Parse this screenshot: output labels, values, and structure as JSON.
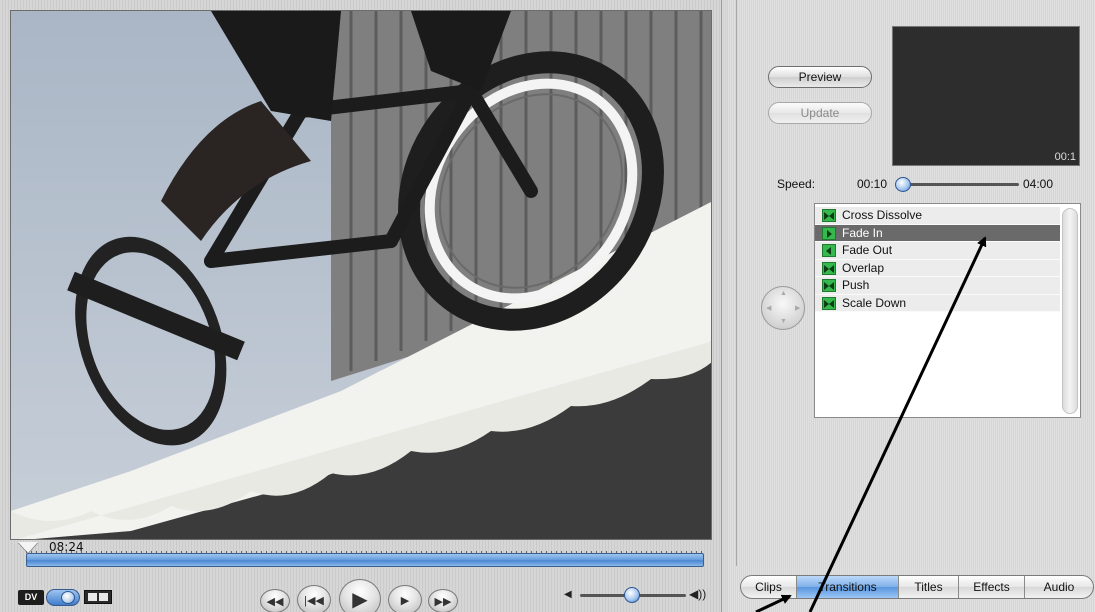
{
  "monitor": {
    "timecode": "08:24",
    "dv_label": "DV",
    "playhead_position": 0.01,
    "volume_level": 0.42
  },
  "transport": {
    "rewind_icon": "rewind-icon",
    "home_icon": "skip-to-start-icon",
    "play_icon": "play-icon",
    "play_full_icon": "play-full-screen-icon",
    "forward_icon": "fast-forward-icon"
  },
  "panel": {
    "preview_label": "Preview",
    "update_label": "Update",
    "preview_time": "00:1",
    "speed_label": "Speed:",
    "speed_min": "00:10",
    "speed_max": "04:00",
    "speed_value": 0.02,
    "transitions": [
      {
        "label": "Cross Dissolve",
        "icon": "both",
        "selected": false
      },
      {
        "label": "Fade In",
        "icon": "right",
        "selected": true
      },
      {
        "label": "Fade Out",
        "icon": "left",
        "selected": false
      },
      {
        "label": "Overlap",
        "icon": "both",
        "selected": false
      },
      {
        "label": "Push",
        "icon": "both",
        "selected": false
      },
      {
        "label": "Scale Down",
        "icon": "both",
        "selected": false
      }
    ]
  },
  "tabs": [
    {
      "label": "Clips",
      "active": false
    },
    {
      "label": "Transitions",
      "active": true
    },
    {
      "label": "Titles",
      "active": false
    },
    {
      "label": "Effects",
      "active": false
    },
    {
      "label": "Audio",
      "active": false
    }
  ],
  "colors": {
    "accent_blue": "#5a96e0",
    "transition_icon_green": "#35b84e",
    "selected_row": "#6a6a6a"
  }
}
